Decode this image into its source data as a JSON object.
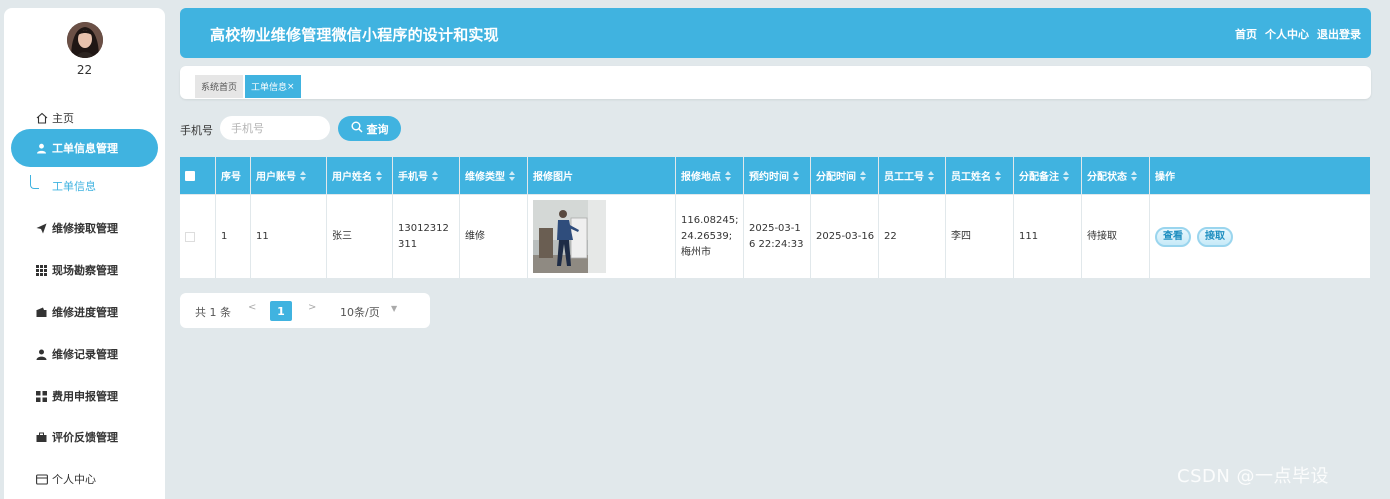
{
  "user": {
    "name": "22"
  },
  "sidebar": {
    "items": [
      {
        "label": "主页"
      },
      {
        "label": "工单信息管理"
      },
      {
        "label": "维修接取管理"
      },
      {
        "label": "现场勘察管理"
      },
      {
        "label": "维修进度管理"
      },
      {
        "label": "维修记录管理"
      },
      {
        "label": "费用申报管理"
      },
      {
        "label": "评价反馈管理"
      },
      {
        "label": "个人中心"
      }
    ],
    "sub_item": "工单信息"
  },
  "header": {
    "title": "高校物业维修管理微信小程序的设计和实现",
    "links": [
      "首页",
      "个人中心",
      "退出登录"
    ]
  },
  "tabs": [
    {
      "label": "系统首页"
    },
    {
      "label": "工单信息",
      "close": "×"
    }
  ],
  "search": {
    "label": "手机号",
    "placeholder": "手机号",
    "value": "",
    "button": "查询"
  },
  "table": {
    "columns": [
      "序号",
      "用户账号",
      "用户姓名",
      "手机号",
      "维修类型",
      "报修图片",
      "报修地点",
      "预约时间",
      "分配时间",
      "员工工号",
      "员工姓名",
      "分配备注",
      "分配状态",
      "操作"
    ],
    "rows": [
      {
        "index": "1",
        "account": "11",
        "name": "张三",
        "phone": "13012312311",
        "repair_type": "维修",
        "location": "116.08245;24.26539;梅州市",
        "appointment": "2025-03-16 22:24:33",
        "assign_time": "2025-03-16",
        "staff_id": "22",
        "staff_name": "李四",
        "remark": "111",
        "status": "待接取",
        "actions": [
          "查看",
          "接取"
        ]
      }
    ]
  },
  "pagination": {
    "total": "共 1 条",
    "prev": "<",
    "current": "1",
    "next": ">",
    "page_size": "10条/页"
  },
  "watermark": "CSDN @一点毕设",
  "colors": {
    "accent": "#40b3e0",
    "background": "#e1e8eb"
  }
}
